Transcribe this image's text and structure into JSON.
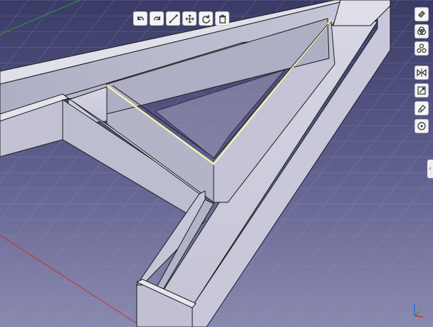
{
  "viewport": {
    "label": "3D view"
  },
  "toolbar": {
    "items": [
      "undo-icon",
      "redo-icon",
      "measure-icon",
      "move-icon",
      "rotate-icon",
      "delete-icon"
    ]
  },
  "nav": {
    "items": [
      "cube-face-icon",
      "boolean-icon",
      "pattern-icon"
    ]
  },
  "right_toolbar": {
    "items": [
      "mirror-icon",
      "sketch-icon",
      "eraser-icon",
      "point-icon"
    ]
  },
  "collapse_tab": {
    "label": "‹"
  },
  "colors": {
    "background_top": "#3a3a66",
    "background_bottom": "#8a8ab0",
    "model_face": "#c9c9d8",
    "model_edge": "#1a1a1a",
    "axis_x": "#d42a2a",
    "axis_y": "#2aa02a",
    "axis_z": "#2a6ad4",
    "selection": "#f5f0b0"
  }
}
